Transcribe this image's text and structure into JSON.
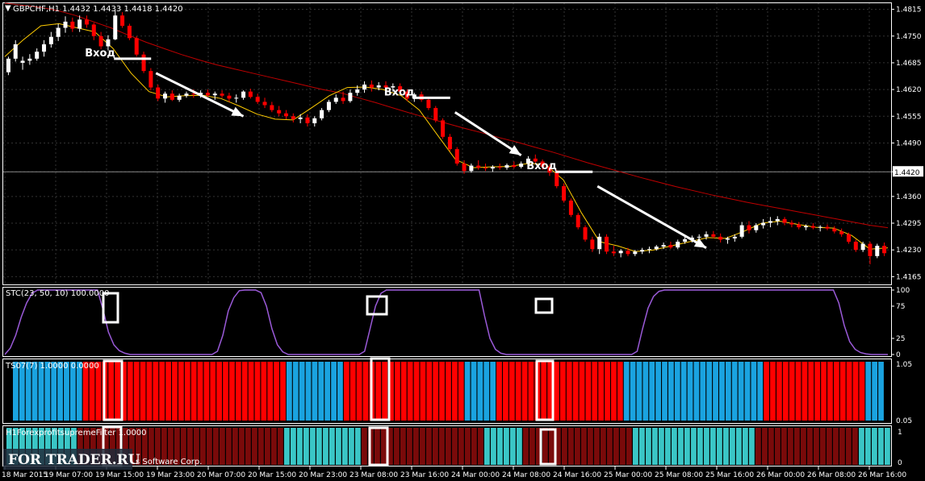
{
  "window": {
    "symbol_header": "GBPCHF,H1  1.4432 1.4433 1.4418 1.4420"
  },
  "watermark": {
    "site": "FOR TRADER.RU",
    "vendor": "s Software Corp."
  },
  "colors": {
    "bull": "#ffffff",
    "bear": "#ff0000",
    "ma_slow": "#c00000",
    "ma_fast": "#ffcc00",
    "stc_line": "#9a5ad8",
    "ts_red": "#ff0000",
    "ts_blue": "#1aa3e0",
    "filter_dark": "#7a0a0a",
    "filter_cyan": "#3ac6c6",
    "arrows": "#ffffff"
  },
  "chart_data": [
    {
      "type": "candlestick",
      "title": "GBPCHF,H1",
      "ohlc_last": {
        "open": 1.4432,
        "high": 1.4433,
        "low": 1.4418,
        "close": 1.442
      },
      "y_ticks": [
        "1.4815",
        "1.4750",
        "1.4685",
        "1.4620",
        "1.4555",
        "1.4490",
        "1.4420",
        "1.4360",
        "1.4295",
        "1.4230",
        "1.4165"
      ],
      "ylim": [
        1.4152,
        1.4822
      ],
      "current_price": "1.4420",
      "x_ticks": [
        "18 Mar 2015",
        "19 Mar 07:00",
        "19 Mar 15:00",
        "19 Mar 23:00",
        "20 Mar 07:00",
        "20 Mar 15:00",
        "20 Mar 23:00",
        "23 Mar 08:00",
        "23 Mar 16:00",
        "24 Mar 00:00",
        "24 Mar 08:00",
        "24 Mar 16:00",
        "25 Mar 00:00",
        "25 Mar 08:00",
        "25 Mar 16:00",
        "26 Mar 00:00",
        "26 Mar 08:00",
        "26 Mar 16:00"
      ],
      "candles": [
        [
          1.4662,
          1.47,
          1.4655,
          1.4695
        ],
        [
          1.4695,
          1.474,
          1.4688,
          1.473
        ],
        [
          1.4685,
          1.47,
          1.4668,
          1.469
        ],
        [
          1.469,
          1.4706,
          1.468,
          1.4695
        ],
        [
          1.4695,
          1.472,
          1.469,
          1.4712
        ],
        [
          1.4712,
          1.474,
          1.47,
          1.473
        ],
        [
          1.473,
          1.476,
          1.4722,
          1.4748
        ],
        [
          1.4748,
          1.478,
          1.4738,
          1.477
        ],
        [
          1.477,
          1.4798,
          1.4758,
          1.4785
        ],
        [
          1.4785,
          1.4795,
          1.476,
          1.4768
        ],
        [
          1.4768,
          1.48,
          1.476,
          1.479
        ],
        [
          1.479,
          1.48,
          1.477,
          1.4778
        ],
        [
          1.4778,
          1.4782,
          1.474,
          1.475
        ],
        [
          1.475,
          1.476,
          1.4718,
          1.4725
        ],
        [
          1.4725,
          1.4752,
          1.4715,
          1.4742
        ],
        [
          1.4742,
          1.4812,
          1.474,
          1.48
        ],
        [
          1.48,
          1.4808,
          1.477,
          1.4775
        ],
        [
          1.4775,
          1.478,
          1.474,
          1.4745
        ],
        [
          1.4745,
          1.475,
          1.47,
          1.4705
        ],
        [
          1.4705,
          1.4712,
          1.466,
          1.4665
        ],
        [
          1.4665,
          1.4672,
          1.4618,
          1.4625
        ],
        [
          1.4625,
          1.4632,
          1.4592,
          1.4598
        ],
        [
          1.4598,
          1.4615,
          1.4588,
          1.461
        ],
        [
          1.461,
          1.4618,
          1.4592,
          1.4595
        ],
        [
          1.4595,
          1.461,
          1.459,
          1.4605
        ],
        [
          1.4605,
          1.4615,
          1.46,
          1.461
        ],
        [
          1.461,
          1.462,
          1.46,
          1.4608
        ],
        [
          1.4608,
          1.4618,
          1.46,
          1.4612
        ],
        [
          1.4612,
          1.462,
          1.4602,
          1.4606
        ],
        [
          1.4606,
          1.4615,
          1.4595,
          1.461
        ],
        [
          1.461,
          1.4618,
          1.46,
          1.4605
        ],
        [
          1.4605,
          1.4612,
          1.459,
          1.4598
        ],
        [
          1.4598,
          1.4608,
          1.4588,
          1.46
        ],
        [
          1.46,
          1.4618,
          1.4595,
          1.4615
        ],
        [
          1.4615,
          1.4622,
          1.4598,
          1.4602
        ],
        [
          1.4602,
          1.461,
          1.4585,
          1.459
        ],
        [
          1.459,
          1.46,
          1.4575,
          1.4582
        ],
        [
          1.4582,
          1.459,
          1.4565,
          1.457
        ],
        [
          1.457,
          1.458,
          1.4555,
          1.4562
        ],
        [
          1.4562,
          1.457,
          1.4548,
          1.4555
        ],
        [
          1.4555,
          1.4562,
          1.454,
          1.4548
        ],
        [
          1.4548,
          1.456,
          1.4538,
          1.4552
        ],
        [
          1.4552,
          1.456,
          1.453,
          1.4538
        ],
        [
          1.4538,
          1.4555,
          1.453,
          1.455
        ],
        [
          1.455,
          1.4575,
          1.4545,
          1.457
        ],
        [
          1.457,
          1.4595,
          1.4565,
          1.459
        ],
        [
          1.459,
          1.4608,
          1.4585,
          1.46
        ],
        [
          1.46,
          1.4615,
          1.4585,
          1.4592
        ],
        [
          1.4592,
          1.462,
          1.4588,
          1.4612
        ],
        [
          1.4612,
          1.463,
          1.4605,
          1.462
        ],
        [
          1.462,
          1.464,
          1.4612,
          1.4632
        ],
        [
          1.4632,
          1.4642,
          1.4615,
          1.4625
        ],
        [
          1.4625,
          1.4638,
          1.4618,
          1.463
        ],
        [
          1.463,
          1.464,
          1.462,
          1.4625
        ],
        [
          1.4625,
          1.4635,
          1.4615,
          1.4628
        ],
        [
          1.4628,
          1.4635,
          1.461,
          1.4615
        ],
        [
          1.4615,
          1.462,
          1.4592,
          1.4598
        ],
        [
          1.4598,
          1.4612,
          1.459,
          1.4608
        ],
        [
          1.4608,
          1.4615,
          1.459,
          1.4595
        ],
        [
          1.4595,
          1.46,
          1.457,
          1.4575
        ],
        [
          1.4575,
          1.458,
          1.454,
          1.4545
        ],
        [
          1.4545,
          1.455,
          1.45,
          1.4505
        ],
        [
          1.4505,
          1.4512,
          1.447,
          1.4475
        ],
        [
          1.4475,
          1.448,
          1.4435,
          1.444
        ],
        [
          1.444,
          1.4448,
          1.4415,
          1.4422
        ],
        [
          1.4422,
          1.444,
          1.4418,
          1.4435
        ],
        [
          1.4435,
          1.4448,
          1.4425,
          1.443
        ],
        [
          1.443,
          1.444,
          1.4422,
          1.4428
        ],
        [
          1.4428,
          1.4436,
          1.442,
          1.4432
        ],
        [
          1.4432,
          1.444,
          1.4425,
          1.443
        ],
        [
          1.443,
          1.444,
          1.4425,
          1.4436
        ],
        [
          1.4436,
          1.4445,
          1.4428,
          1.4432
        ],
        [
          1.4432,
          1.4445,
          1.4428,
          1.444
        ],
        [
          1.444,
          1.4458,
          1.4436,
          1.4452
        ],
        [
          1.4452,
          1.4462,
          1.444,
          1.4445
        ],
        [
          1.4445,
          1.445,
          1.4425,
          1.4432
        ],
        [
          1.4432,
          1.4438,
          1.441,
          1.4418
        ],
        [
          1.4418,
          1.4425,
          1.438,
          1.4385
        ],
        [
          1.4385,
          1.4392,
          1.4345,
          1.435
        ],
        [
          1.435,
          1.4355,
          1.431,
          1.4315
        ],
        [
          1.4315,
          1.432,
          1.428,
          1.4285
        ],
        [
          1.4285,
          1.429,
          1.425,
          1.4255
        ],
        [
          1.4255,
          1.4262,
          1.4225,
          1.4232
        ],
        [
          1.4232,
          1.427,
          1.422,
          1.4262
        ],
        [
          1.4262,
          1.4268,
          1.422,
          1.4226
        ],
        [
          1.4226,
          1.424,
          1.4215,
          1.4222
        ],
        [
          1.4222,
          1.4232,
          1.4212,
          1.4228
        ],
        [
          1.4228,
          1.4235,
          1.4215,
          1.422
        ],
        [
          1.422,
          1.423,
          1.4215,
          1.4226
        ],
        [
          1.4226,
          1.4235,
          1.422,
          1.423
        ],
        [
          1.423,
          1.4238,
          1.4222,
          1.4232
        ],
        [
          1.4232,
          1.4242,
          1.4228,
          1.4238
        ],
        [
          1.4238,
          1.4248,
          1.4232,
          1.4242
        ],
        [
          1.4242,
          1.425,
          1.4232,
          1.4236
        ],
        [
          1.4236,
          1.4255,
          1.4232,
          1.425
        ],
        [
          1.425,
          1.4262,
          1.4245,
          1.4256
        ],
        [
          1.4256,
          1.4265,
          1.4248,
          1.426
        ],
        [
          1.426,
          1.4268,
          1.425,
          1.4262
        ],
        [
          1.4262,
          1.4275,
          1.4255,
          1.4268
        ],
        [
          1.4268,
          1.4276,
          1.4258,
          1.4262
        ],
        [
          1.4262,
          1.427,
          1.4248,
          1.4255
        ],
        [
          1.4255,
          1.4262,
          1.4245,
          1.4258
        ],
        [
          1.4258,
          1.4268,
          1.425,
          1.4262
        ],
        [
          1.4262,
          1.4298,
          1.4258,
          1.429
        ],
        [
          1.429,
          1.43,
          1.427,
          1.4278
        ],
        [
          1.4278,
          1.4295,
          1.4272,
          1.429
        ],
        [
          1.429,
          1.4305,
          1.4282,
          1.4296
        ],
        [
          1.4296,
          1.431,
          1.4285,
          1.43
        ],
        [
          1.43,
          1.4312,
          1.429,
          1.4305
        ],
        [
          1.4305,
          1.431,
          1.429,
          1.4296
        ],
        [
          1.4296,
          1.4302,
          1.4285,
          1.4292
        ],
        [
          1.4292,
          1.4298,
          1.428,
          1.4285
        ],
        [
          1.4285,
          1.4292,
          1.4278,
          1.4288
        ],
        [
          1.4288,
          1.4295,
          1.428,
          1.4284
        ],
        [
          1.4284,
          1.429,
          1.4275,
          1.4286
        ],
        [
          1.4286,
          1.4292,
          1.4278,
          1.4282
        ],
        [
          1.4282,
          1.4288,
          1.427,
          1.4275
        ],
        [
          1.4275,
          1.4282,
          1.4262,
          1.4268
        ],
        [
          1.4268,
          1.4272,
          1.4245,
          1.425
        ],
        [
          1.425,
          1.4255,
          1.4225,
          1.423
        ],
        [
          1.423,
          1.425,
          1.4225,
          1.4245
        ],
        [
          1.4245,
          1.425,
          1.4195,
          1.4215
        ],
        [
          1.4215,
          1.4245,
          1.421,
          1.424
        ],
        [
          1.424,
          1.4248,
          1.4215,
          1.4222
        ]
      ],
      "series": [
        {
          "name": "",
          "values_ref": "ma_slow",
          "color": "#c00000"
        },
        {
          "name": "",
          "values_ref": "ma_fast",
          "color": "#ffcc00"
        }
      ],
      "ma_slow": [
        1.483,
        1.4825,
        1.482,
        1.4812,
        1.48,
        1.4785,
        1.477,
        1.4752,
        1.4735,
        1.472,
        1.4705,
        1.4692,
        1.468,
        1.467,
        1.466,
        1.465,
        1.464,
        1.463,
        1.462,
        1.4612,
        1.46,
        1.4588,
        1.4575,
        1.4562,
        1.455,
        1.4538,
        1.4526,
        1.4515,
        1.4503,
        1.4492,
        1.448,
        1.4468,
        1.4455,
        1.4442,
        1.443,
        1.4418,
        1.4406,
        1.4395,
        1.4384,
        1.4374,
        1.4364,
        1.4355,
        1.4346,
        1.4338,
        1.433,
        1.4322,
        1.4314,
        1.4306,
        1.4298,
        1.429,
        1.4284
      ],
      "ma_fast": [
        1.47,
        1.474,
        1.4775,
        1.478,
        1.477,
        1.476,
        1.472,
        1.466,
        1.4615,
        1.4602,
        1.4605,
        1.4606,
        1.4598,
        1.458,
        1.456,
        1.4548,
        1.4546,
        1.4575,
        1.4605,
        1.4625,
        1.4626,
        1.462,
        1.4605,
        1.457,
        1.451,
        1.445,
        1.443,
        1.4432,
        1.4433,
        1.444,
        1.4438,
        1.44,
        1.432,
        1.425,
        1.424,
        1.4226,
        1.423,
        1.424,
        1.425,
        1.426,
        1.4258,
        1.4275,
        1.4295,
        1.43,
        1.4292,
        1.4285,
        1.4283,
        1.4265,
        1.4232,
        1.4235
      ],
      "annotations": [
        {
          "text": "Вход",
          "entry_price": 1.4695,
          "candle": 18
        },
        {
          "text": "Вход",
          "entry_price": 1.46,
          "candle": 60
        },
        {
          "text": "Вход",
          "entry_price": 1.442,
          "candle": 80
        }
      ]
    },
    {
      "type": "line",
      "title": "STC(23, 50, 10) 100.0000",
      "y_ticks": [
        "100",
        "75",
        "25",
        "0"
      ],
      "ylim": [
        0,
        100
      ],
      "series": [
        {
          "name": "STC(23, 50, 10)",
          "values": [
            0,
            10,
            30,
            58,
            80,
            95,
            100,
            100,
            100,
            100,
            100,
            100,
            100,
            100,
            100,
            100,
            100,
            100,
            70,
            35,
            15,
            6,
            2,
            0,
            0,
            0,
            0,
            0,
            0,
            0,
            0,
            0,
            0,
            0,
            0,
            0,
            0,
            0,
            0,
            5,
            30,
            68,
            88,
            99,
            100,
            100,
            100,
            96,
            75,
            40,
            15,
            4,
            0,
            0,
            0,
            0,
            0,
            0,
            0,
            0,
            0,
            0,
            0,
            0,
            0,
            0,
            5,
            40,
            75,
            95,
            100,
            100,
            100,
            100,
            100,
            100,
            100,
            100,
            100,
            100,
            100,
            100,
            100,
            100,
            100,
            100,
            100,
            100,
            60,
            25,
            8,
            2,
            0,
            0,
            0,
            0,
            0,
            0,
            0,
            0,
            0,
            0,
            0,
            0,
            0,
            0,
            0,
            0,
            0,
            0,
            0,
            0,
            0,
            0,
            0,
            0,
            5,
            40,
            72,
            90,
            98,
            100,
            100,
            100,
            100,
            100,
            100,
            100,
            100,
            100,
            100,
            100,
            100,
            100,
            100,
            100,
            100,
            100,
            100,
            100,
            100,
            100,
            100,
            100,
            100,
            100,
            100,
            100,
            100,
            100,
            100,
            100,
            100,
            80,
            45,
            20,
            8,
            3,
            1,
            0,
            0,
            0,
            0
          ]
        }
      ]
    },
    {
      "type": "bar",
      "title": "TS07(7) 1.0000 0.0000",
      "y_ticks": [
        "1.05",
        "0.05"
      ],
      "segments": [
        [
          "blue",
          0,
          11
        ],
        [
          "red",
          11,
          43
        ],
        [
          "blue",
          43,
          52
        ],
        [
          "red",
          52,
          71
        ],
        [
          "blue",
          71,
          76
        ],
        [
          "red",
          76,
          96
        ],
        [
          "blue",
          96,
          118
        ],
        [
          "red",
          118,
          134
        ],
        [
          "blue",
          134,
          137
        ]
      ]
    },
    {
      "type": "bar",
      "title": "H1ForexprofitsupremeFilter 1.0000",
      "y_ticks": [
        "1",
        "0"
      ],
      "segments": [
        [
          "cyan",
          0,
          11
        ],
        [
          "dark",
          11,
          43
        ],
        [
          "cyan",
          43,
          55
        ],
        [
          "dark",
          55,
          74
        ],
        [
          "cyan",
          74,
          80
        ],
        [
          "dark",
          80,
          97
        ],
        [
          "cyan",
          97,
          116
        ],
        [
          "dark",
          116,
          132
        ],
        [
          "cyan",
          132,
          137
        ]
      ]
    }
  ]
}
